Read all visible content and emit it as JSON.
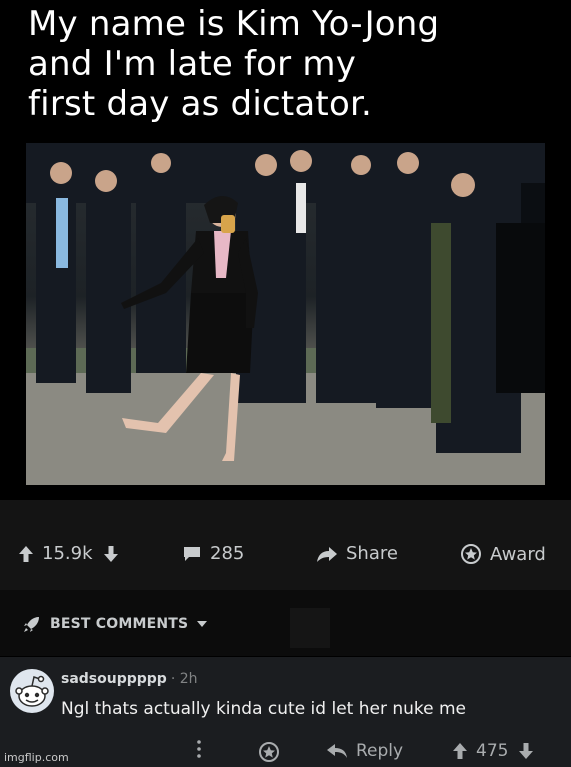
{
  "caption": {
    "line1": "My name is Kim Yo-Jong",
    "line2": "and I'm late for my",
    "line3": "first day as dictator."
  },
  "post": {
    "upvotes": "15.9k",
    "comments": "285",
    "share_label": "Share",
    "award_label": "Award"
  },
  "sort": {
    "label": "BEST COMMENTS"
  },
  "comment": {
    "username": "sadsouppppp",
    "age": "· 2h",
    "text": "Ngl thats actually kinda cute id let her nuke me",
    "reply_label": "Reply",
    "score": "475"
  },
  "watermark": "imgflip.com",
  "colors": {
    "background": "#000000",
    "action_bar": "#141414",
    "comment_bg": "#1b1d20",
    "text_muted": "#818384"
  },
  "icons": [
    "upvote-icon",
    "downvote-icon",
    "comment-icon",
    "share-icon",
    "award-icon",
    "rocket-icon",
    "caret-down-icon",
    "more-icon",
    "reply-icon",
    "snoo-avatar-icon"
  ]
}
